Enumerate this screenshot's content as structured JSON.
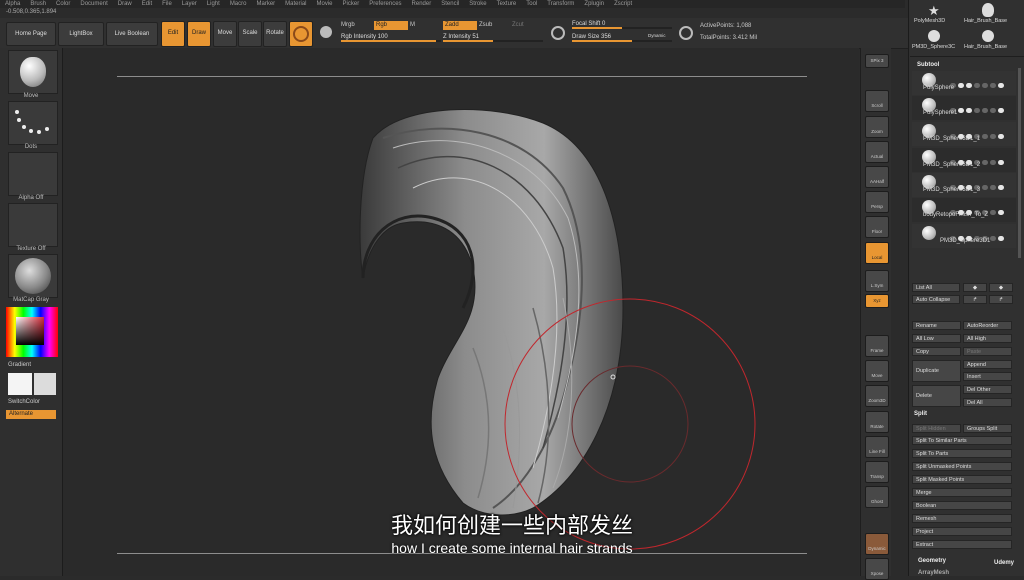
{
  "menu": [
    "Alpha",
    "Brush",
    "Color",
    "Document",
    "Draw",
    "Edit",
    "File",
    "Layer",
    "Light",
    "Macro",
    "Marker",
    "Material",
    "Movie",
    "Picker",
    "Preferences",
    "Render",
    "Stencil",
    "Stroke",
    "Texture",
    "Tool",
    "Transform",
    "Zplugin",
    "Zscript"
  ],
  "coords": "-0.508,0.365,1.894",
  "topbar": {
    "home_page": "Home Page",
    "lightbox": "LightBox",
    "live_boolean": "Live Boolean",
    "edit": "Edit",
    "draw": "Draw",
    "move": "Move",
    "scale": "Scale",
    "rotate": "Rotate",
    "mrgb": "Mrgb",
    "rgb": "Rgb",
    "m": "M",
    "rgb_intensity": "Rgb Intensity 100",
    "zadd": "Zadd",
    "zsub": "Zsub",
    "zcut": "Zcut",
    "z_intensity": "Z Intensity 51",
    "focal_shift": "Focal Shift 0",
    "draw_size": "Draw Size 356",
    "dynamic": "Dynamic",
    "active_points": "ActivePoints: 1,088",
    "total_points": "TotalPoints: 3.412 Mil"
  },
  "left": {
    "move": "Move",
    "dots": "Dots",
    "alpha_off": "Alpha Off",
    "texture_off": "Texture Off",
    "matcap_gray": "MatCap Gray",
    "gradient": "Gradient",
    "switchcolor": "SwitchColor",
    "alternate": "Alternate"
  },
  "rightcol": [
    "SPix 3",
    "Scroll",
    "Zoom",
    "Actual",
    "AAHalf",
    "Persp",
    "Floor",
    "Local",
    "L.Sym",
    "Xyz",
    "Frame",
    "Move",
    "Zoom3D",
    "Rotate",
    "Line Fill PolyF",
    "Transp",
    "Ghost",
    "Dynamic Solo",
    "Xpose"
  ],
  "panel": {
    "top_tools": [
      "PolyMesh3D",
      "Hair_Brush_Base",
      "PM3D_Sphere3C",
      "Hair_Brush_Base"
    ],
    "subtool_title": "Subtool",
    "subtools": [
      "PolySphere",
      "PolySphere1",
      "PM3D_Sphere3D1_1",
      "PM3D_Sphere3D1_2",
      "PM3D_Sphere3D1_3",
      "bodyRetopoFinish_To_Z",
      "PM3D_Sphere3D1"
    ],
    "list_all": "List All",
    "auto_collapse": "Auto Collapse",
    "rename": "Rename",
    "autoreorder": "AutoReorder",
    "all_low": "All Low",
    "all_high": "All High",
    "copy": "Copy",
    "paste": "Paste",
    "duplicate": "Duplicate",
    "append": "Append",
    "insert": "Insert",
    "delete": "Delete",
    "del_other": "Del Other",
    "del_all": "Del All",
    "split": "Split",
    "split_hidden": "Split Hidden",
    "groups_split": "Groups Split",
    "split_similar": "Split To Similar Parts",
    "split_parts": "Split To Parts",
    "split_unmasked": "Split Unmasked Points",
    "split_masked": "Split Masked Points",
    "merge": "Merge",
    "boolean": "Boolean",
    "remesh": "Remesh",
    "project": "Project",
    "extract": "Extract",
    "geometry": "Geometry",
    "arraymesh": "ArrayMesh",
    "udemy": "Udemy"
  },
  "subtitles": {
    "cn": "我如何创建一些内部发丝",
    "en": "how I create some internal hair strands"
  },
  "colors": {
    "accent": "#e89632",
    "brush_circle": "#c0272d"
  }
}
